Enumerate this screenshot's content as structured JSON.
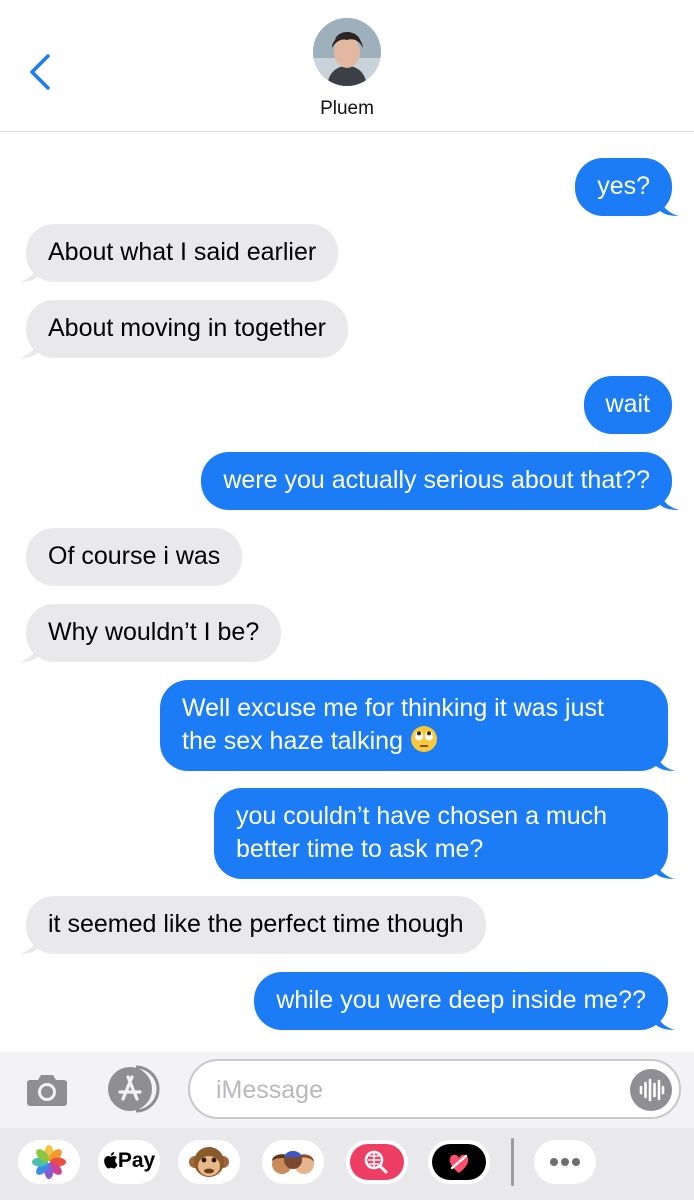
{
  "header": {
    "contact_name": "Pluem",
    "back_icon": "chevron-left-icon"
  },
  "colors": {
    "outgoing_bubble": "#1b7cf5",
    "incoming_bubble": "#e9e9eb",
    "accent": "#1b7cf5"
  },
  "messages": [
    {
      "direction": "out",
      "text": "yes?"
    },
    {
      "direction": "in",
      "text": "About what I said earlier"
    },
    {
      "direction": "in",
      "text": "About moving in together"
    },
    {
      "direction": "out",
      "text": "wait"
    },
    {
      "direction": "out",
      "text": "were you actually serious about that??"
    },
    {
      "direction": "in",
      "text": "Of course i was"
    },
    {
      "direction": "in",
      "text": "Why wouldn’t I be?"
    },
    {
      "direction": "out",
      "text": "Well excuse me for thinking it was just",
      "text_line2": "the sex haze talking",
      "emoji": "face-with-rolling-eyes"
    },
    {
      "direction": "out",
      "text": "you couldn’t have chosen a much",
      "text_line2": "better time to ask me?"
    },
    {
      "direction": "in",
      "text": "it seemed like the perfect time though"
    },
    {
      "direction": "out",
      "text": "while you were deep inside me??"
    }
  ],
  "input_bar": {
    "placeholder": "iMessage",
    "value": "",
    "camera_icon": "camera-icon",
    "appstore_icon": "app-store-icon",
    "audio_icon": "audio-waveform-icon"
  },
  "app_drawer": {
    "items": [
      {
        "name": "photos-icon"
      },
      {
        "name": "apple-pay",
        "label": "Pay"
      },
      {
        "name": "monkey-animoji-icon"
      },
      {
        "name": "memoji-stickers-icon"
      },
      {
        "name": "web-search-icon"
      },
      {
        "name": "digital-touch-icon"
      },
      {
        "name": "more-apps-icon"
      }
    ]
  }
}
